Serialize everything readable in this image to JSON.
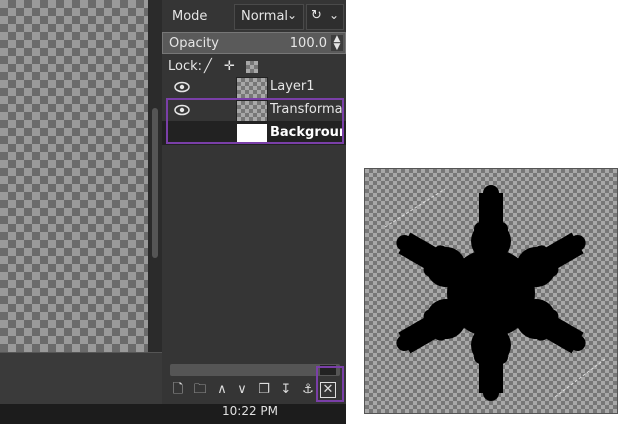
{
  "layers_panel": {
    "mode_label": "Mode",
    "mode_value": "Normal",
    "opacity_label": "Opacity",
    "opacity_value": "100.0",
    "lock_label": "Lock:",
    "layers": [
      {
        "name": "Layer1",
        "visible": true,
        "thumbnail": "transparent"
      },
      {
        "name": "Transformatic",
        "visible": true,
        "thumbnail": "transparent",
        "selected": true
      },
      {
        "name": "Backgrounc",
        "visible": false,
        "thumbnail": "white",
        "bold": true
      }
    ],
    "toolbar_icons": [
      "new-layer-icon",
      "new-layer-group-icon",
      "raise-layer-icon",
      "lower-layer-icon",
      "duplicate-layer-icon",
      "merge-down-icon",
      "anchor-layer-icon",
      "delete-layer-icon"
    ]
  },
  "taskbar": {
    "clock": "10:22 PM"
  },
  "colors": {
    "panel_bg": "#353535",
    "highlight_border": "#7a3fa8",
    "dark_bg": "#1c1c1c"
  }
}
